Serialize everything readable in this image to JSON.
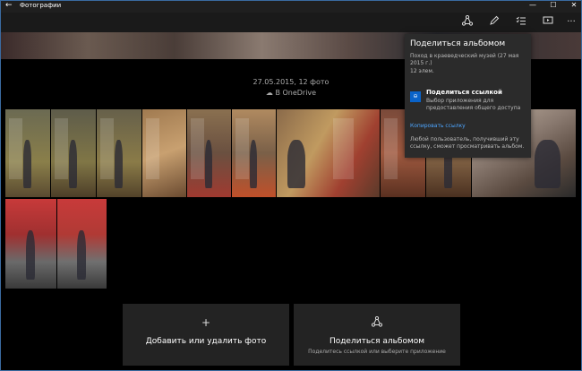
{
  "window": {
    "title": "Фотографии",
    "back": "←",
    "minimize": "—",
    "maximize": "☐",
    "close": "✕"
  },
  "toolbar": {
    "share_icon": "share-icon",
    "edit_icon": "pencil-icon",
    "select_icon": "select-icon",
    "slideshow_icon": "slideshow-icon",
    "more": "···"
  },
  "hero": {
    "text": "...  ..."
  },
  "album": {
    "date_info": "27.05.2015, 12 фото",
    "onedrive": "В OneDrive"
  },
  "flyout": {
    "title": "Поделиться альбомом",
    "subtitle": "Поход в краеведческий музей (27 мая 2015 г.)",
    "count": "12 элем.",
    "link_title": "Поделиться ссылкой",
    "link_desc": "Выбор приложения для предоставления общего доступа",
    "copy_link": "Копировать ссылку",
    "note": "Любой пользователь, получивший эту ссылку, сможет просматривать альбом."
  },
  "actions": {
    "add": {
      "icon": "+",
      "label": "Добавить или удалить фото"
    },
    "share": {
      "icon": "share-icon",
      "label": "Поделиться альбомом",
      "sub": "Поделитесь ссылкой или выберите приложение"
    }
  },
  "colors": {
    "accent": "#0a63c9",
    "link": "#4ea6ff",
    "background": "#000000"
  }
}
